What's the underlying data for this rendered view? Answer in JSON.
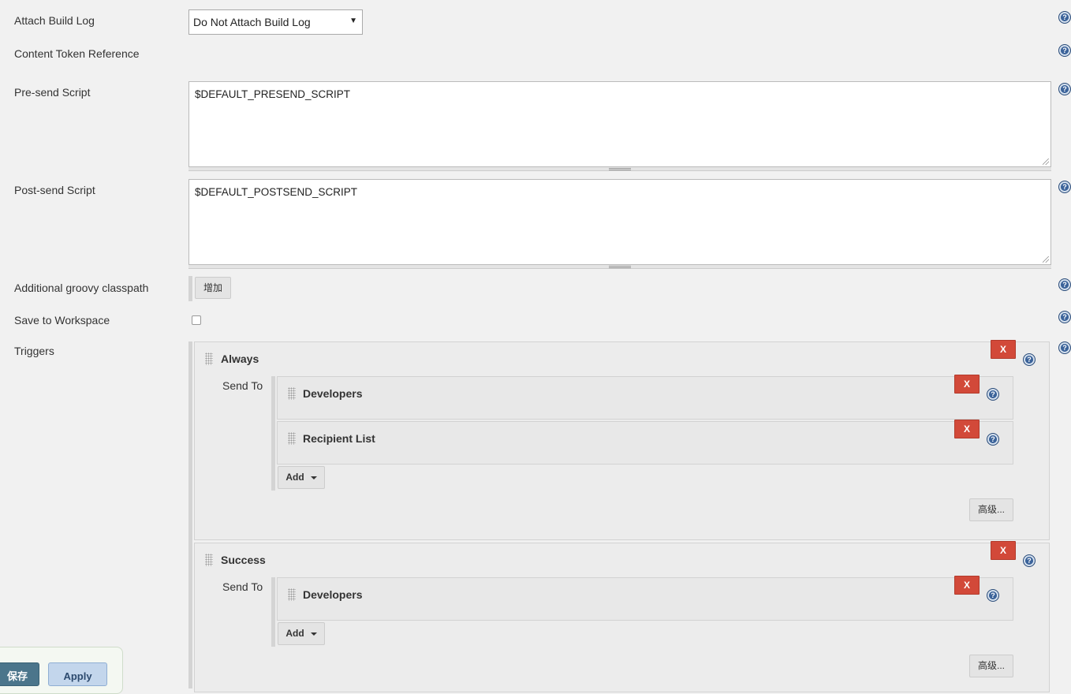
{
  "fields": {
    "attach_build_log": {
      "label": "Attach Build Log",
      "value": "Do Not Attach Build Log"
    },
    "content_token": {
      "label": "Content Token Reference"
    },
    "presend": {
      "label": "Pre-send Script",
      "value": "$DEFAULT_PRESEND_SCRIPT"
    },
    "postsend": {
      "label": "Post-send Script",
      "value": "$DEFAULT_POSTSEND_SCRIPT"
    },
    "classpath": {
      "label": "Additional groovy classpath",
      "button": "增加"
    },
    "workspace": {
      "label": "Save to Workspace",
      "checked": false
    },
    "triggers": {
      "label": "Triggers"
    }
  },
  "triggers": [
    {
      "title": "Always",
      "send_to_label": "Send To",
      "recipients": [
        "Developers",
        "Recipient List"
      ],
      "add_label": "Add",
      "advanced_label": "高级...",
      "remove_label": "X"
    },
    {
      "title": "Success",
      "send_to_label": "Send To",
      "recipients": [
        "Developers"
      ],
      "add_label": "Add",
      "advanced_label": "高级...",
      "remove_label": "X"
    }
  ],
  "footer": {
    "save_label": "保存",
    "apply_label": "Apply"
  },
  "colors": {
    "remove": "#d24939",
    "save": "#4b758b",
    "apply": "#c3d6ec",
    "help": "#4a6fa0"
  }
}
